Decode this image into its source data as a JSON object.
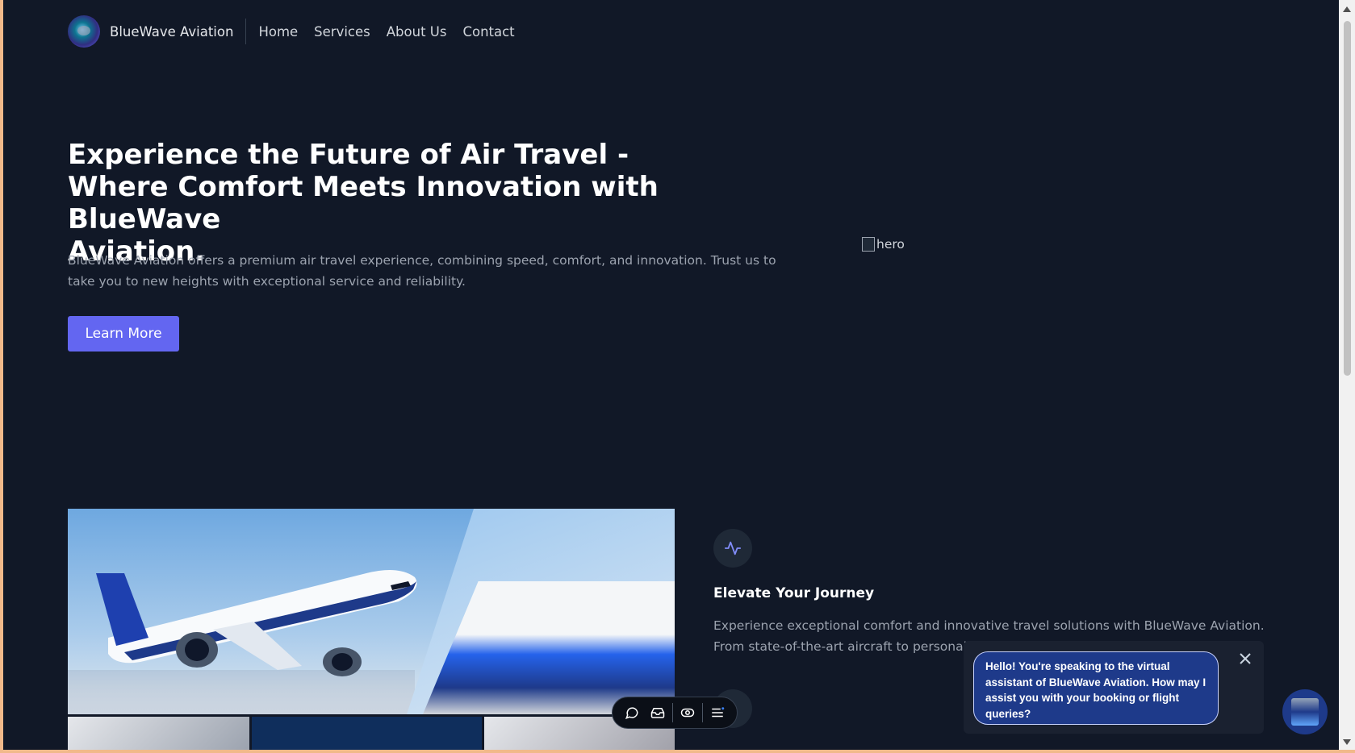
{
  "header": {
    "brand": "BlueWave Aviation",
    "nav": [
      "Home",
      "Services",
      "About Us",
      "Contact"
    ]
  },
  "hero": {
    "title_line1": "Experience the Future of Air Travel -",
    "title_line2": "Where Comfort Meets Innovation with BlueWave",
    "title_line3": "Aviation.",
    "text": "BlueWave Aviation offers a premium air travel experience, combining speed, comfort, and innovation. Trust us to take you to new heights with exceptional service and reliability.",
    "button_label": "Learn More",
    "image_alt": "hero"
  },
  "feature": {
    "icon": "activity-icon",
    "title": "Elevate Your Journey",
    "text": "Experience exceptional comfort and innovative travel solutions with BlueWave Aviation. From state-of-the-art aircraft to personalized service, we"
  },
  "chat": {
    "message": "Hello! You're speaking to the virtual assistant of BlueWave Aviation. How may I assist you with your booking or flight queries?"
  },
  "toolbar": {
    "icons": [
      "comment-icon",
      "inbox-icon",
      "eye-icon",
      "menu-icon"
    ]
  },
  "colors": {
    "background": "#111827",
    "accent": "#6366f1",
    "chat_bubble": "#1e3a8a"
  }
}
